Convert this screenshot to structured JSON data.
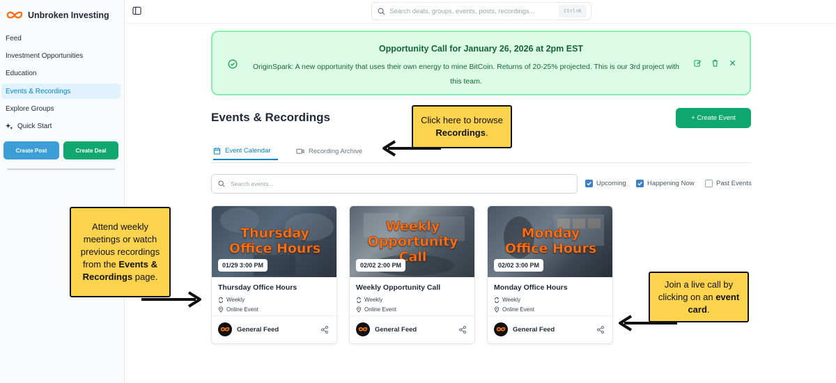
{
  "sidebar": {
    "brand": "Unbroken Investing",
    "items": [
      {
        "label": "Feed"
      },
      {
        "label": "Investment Opportunities"
      },
      {
        "label": "Education"
      },
      {
        "label": "Events & Recordings"
      },
      {
        "label": "Explore Groups"
      },
      {
        "label": "Quick Start"
      }
    ],
    "create_post": "Create Post",
    "create_deal": "Create Deal"
  },
  "topbar": {
    "search_placeholder": "Search deals, groups, events, posts, recordings...",
    "shortcut": "Ctrl+K"
  },
  "banner": {
    "title": "Opportunity Call for January 26, 2026 at 2pm EST",
    "body": "OriginSpark: A new opportunity that uses their own energy to mine BitCoin. Returns of 20-25% projected. This is our 3rd project with this team."
  },
  "page": {
    "title": "Events & Recordings",
    "create_event": "+ Create Event"
  },
  "tabs": [
    {
      "label": "Event Calendar"
    },
    {
      "label": "Recording Archive"
    }
  ],
  "events_search": {
    "placeholder": "Search events..."
  },
  "filters": [
    {
      "label": "Upcoming",
      "checked": true
    },
    {
      "label": "Happening Now",
      "checked": true
    },
    {
      "label": "Past Events",
      "checked": false
    }
  ],
  "events": [
    {
      "image_line1": "Thursday",
      "image_line2": "Office Hours",
      "date": "01/29 3:00 PM",
      "title": "Thursday Office Hours",
      "recurrence": "Weekly",
      "location": "Online Event",
      "group": "General Feed"
    },
    {
      "image_line1": "Weekly",
      "image_line2": "Opportunity",
      "image_line3": "Call",
      "date": "02/02 2:00 PM",
      "title": "Weekly Opportunity Call",
      "recurrence": "Weekly",
      "location": "Online Event",
      "group": "General Feed"
    },
    {
      "image_line1": "Monday",
      "image_line2": "Office Hours",
      "date": "02/02 3:00 PM",
      "title": "Monday Office Hours",
      "recurrence": "Weekly",
      "location": "Online Event",
      "group": "General Feed"
    }
  ],
  "callouts": {
    "recordings": {
      "pre": "Click here to browse ",
      "bold": "Recordings",
      "post": "."
    },
    "attend": {
      "pre": "Attend weekly meetings or watch previous recordings from the ",
      "bold": "Events & Recordings",
      "post": " page."
    },
    "join": {
      "pre": "Join a live call by clicking on an ",
      "bold": "event card",
      "post": "."
    }
  },
  "colors": {
    "accent": "#0284c7",
    "green": "#10a870",
    "banner_bg": "#dcfce7",
    "callout": "#fcd34d",
    "image_text": "#f97316"
  }
}
